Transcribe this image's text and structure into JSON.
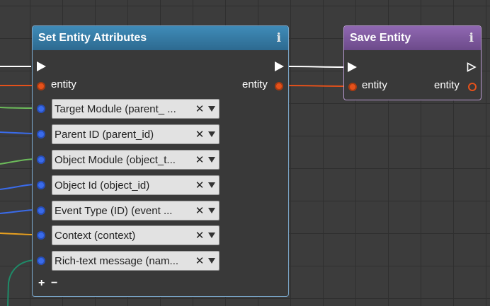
{
  "nodes": {
    "set_attributes": {
      "title": "Set Entity Attributes",
      "info_icon": "i",
      "input_label": "entity",
      "output_label": "entity",
      "fields": [
        {
          "text": "Target Module (parent_ ...",
          "pin_color": "#3a6bea"
        },
        {
          "text": "Parent ID (parent_id)",
          "pin_color": "#3a6bea"
        },
        {
          "text": "Object Module (object_t...",
          "pin_color": "#3a6bea"
        },
        {
          "text": "Object Id (object_id)",
          "pin_color": "#3a6bea"
        },
        {
          "text": "Event Type (ID) (event ...",
          "pin_color": "#3a6bea"
        },
        {
          "text": "Context (context)",
          "pin_color": "#3a6bea"
        },
        {
          "text": "Rich-text message (nam...",
          "pin_color": "#3a6bea"
        }
      ],
      "clear_glyph": "✕",
      "add_label": "+",
      "remove_label": "−",
      "header_color": "#3f8bb8"
    },
    "save_entity": {
      "title": "Save Entity",
      "info_icon": "i",
      "input_label": "entity",
      "output_label": "entity",
      "header_color": "#9068b2"
    }
  },
  "wire_colors": {
    "exec": "#ffffff",
    "entity": "#e5511a",
    "green": "#6cbb5a",
    "blue": "#3a6bea",
    "orange": "#e8a020",
    "teal": "#1f8a68"
  }
}
